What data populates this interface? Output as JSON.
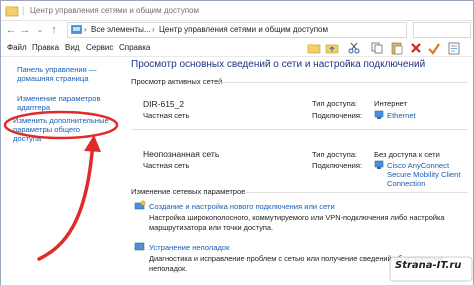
{
  "window": {
    "title": "Центр управления сетями и общим доступом"
  },
  "address_bar": {
    "crumbs": [
      "Все элементы...",
      "Центр управления сетями и общим доступом"
    ]
  },
  "menu": [
    "Файл",
    "Правка",
    "Вид",
    "Сервис",
    "Справка"
  ],
  "sidebar": {
    "items": [
      {
        "label": "Панель управления — домашняя страница"
      },
      {
        "label": "Изменение параметров адаптера"
      },
      {
        "label": "Изменить дополнительные параметры общего доступа"
      }
    ]
  },
  "main": {
    "title": "Просмотр основных сведений о сети и настройка подключений",
    "active_networks_heading": "Просмотр активных сетей",
    "networks": [
      {
        "name": "DIR-615_2",
        "type": "Частная сеть",
        "access_type_label": "Тип доступа:",
        "access_type_value": "Интернет",
        "connections_label": "Подключения:",
        "connection": "Ethernet"
      },
      {
        "name": "Неопознанная сеть",
        "type": "Частная сеть",
        "access_type_label": "Тип доступа:",
        "access_type_value": "Без доступа к сети",
        "connections_label": "Подключения:",
        "connection": "Cisco AnyConnect Secure Mobility Client Connection"
      }
    ],
    "change_settings_heading": "Изменение сетевых параметров",
    "tasks": [
      {
        "link": "Создание и настройка нового подключения или сети",
        "description": "Настройка широкополосного, коммутируемого или VPN-подключения либо настройка маршрутизатора или точки доступа."
      },
      {
        "link": "Устранение неполадок",
        "description": "Диагностика и исправление проблем с сетью или получение сведений об устранении неполадок."
      }
    ]
  },
  "watermark": {
    "text": "Strana-IT.ru"
  },
  "colors": {
    "link": "#1a5fb4",
    "title": "#1e3287",
    "highlight": "#e02b2b"
  }
}
